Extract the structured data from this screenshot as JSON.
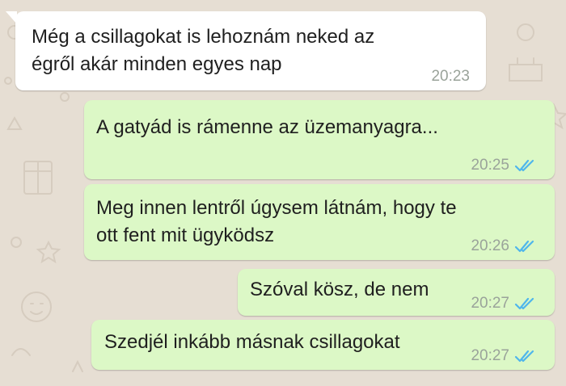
{
  "colors": {
    "chat_background": "#e6ded3",
    "incoming_bubble": "#ffffff",
    "outgoing_bubble": "#dcf8c6",
    "read_ticks": "#4fb6ec",
    "timestamp": "#9aa39a"
  },
  "messages": [
    {
      "direction": "incoming",
      "lines": [
        "Még a csillagokat is lehoznám neked az",
        "égről akár minden egyes nap"
      ],
      "time": "20:23",
      "status_icon": null
    },
    {
      "direction": "outgoing",
      "lines": [
        "A gatyád is rámenne az üzemanyagra..."
      ],
      "time": "20:25",
      "status_icon": "double-check-read-icon"
    },
    {
      "direction": "outgoing",
      "lines": [
        "Meg innen lentről úgysem  látnám, hogy te",
        "ott fent mit ügyködsz"
      ],
      "time": "20:26",
      "status_icon": "double-check-read-icon"
    },
    {
      "direction": "outgoing",
      "lines": [
        "Szóval kösz, de nem"
      ],
      "time": "20:27",
      "status_icon": "double-check-read-icon"
    },
    {
      "direction": "outgoing",
      "lines": [
        "Szedjél inkább másnak csillagokat"
      ],
      "time": "20:27",
      "status_icon": "double-check-read-icon"
    }
  ]
}
